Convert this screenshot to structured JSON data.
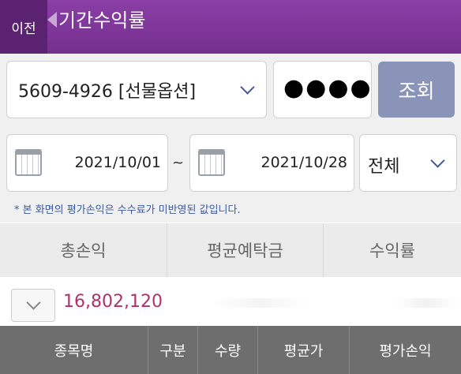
{
  "header": {
    "back_label": "이전",
    "title": "기간수익률"
  },
  "account": {
    "value": "5609-4926 [선물옵션]"
  },
  "password": {
    "masked": "●●●●"
  },
  "query_button": {
    "label": "조회"
  },
  "date_range": {
    "start": "2021/10/01",
    "separator": "~",
    "end": "2021/10/28"
  },
  "filter": {
    "value": "전체"
  },
  "notice": "* 본 화면의 평가손익은 수수료가 미반영된 값입니다.",
  "summary": {
    "headers": [
      "총손익",
      "평균예탁금",
      "수익률"
    ],
    "total_pl": "16,802,120"
  },
  "list_headers": [
    "종목명",
    "구분",
    "수량",
    "평균가",
    "평가손익"
  ],
  "colors": {
    "header_bg": "#7b3495",
    "accent_red": "#b0306a",
    "query_bg": "#8a93b8"
  }
}
